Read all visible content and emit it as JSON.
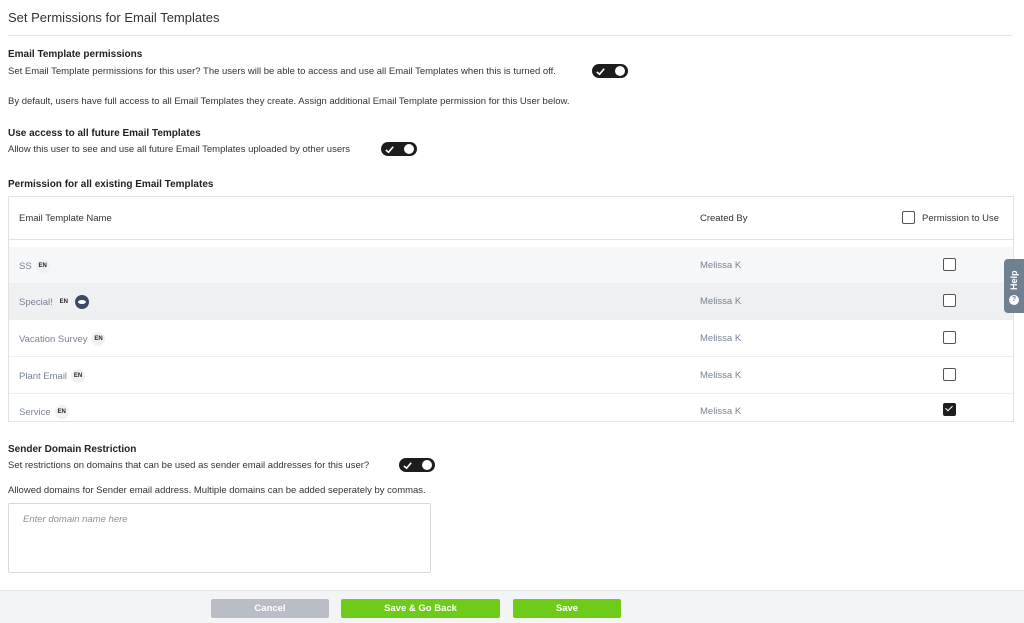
{
  "page": {
    "title": "Set Permissions for Email Templates"
  },
  "email_permissions": {
    "heading": "Email Template permissions",
    "description": "Set Email Template permissions for this user? The users will be able to access and use all Email Templates when this is turned off.",
    "toggle_on": true,
    "note": "By default, users have full access to all Email Templates they create. Assign additional Email Template permission for this User below."
  },
  "future_access": {
    "heading": "Use access to all future Email Templates",
    "description": "Allow this user to see and use all future Email Templates uploaded by other users",
    "toggle_on": true
  },
  "existing": {
    "heading": "Permission for all existing Email Templates",
    "columns": {
      "name": "Email Template Name",
      "created_by": "Created By",
      "permission": "Permission to Use"
    },
    "rows": [
      {
        "name": "SS",
        "lang": "EN",
        "created_by": "Melissa K",
        "permitted": false,
        "highlight": true,
        "preview": false
      },
      {
        "name": "Special!",
        "lang": "EN",
        "created_by": "Melissa K",
        "permitted": false,
        "highlight": true,
        "preview": true
      },
      {
        "name": "Vacation Survey",
        "lang": "EN",
        "created_by": "Melissa K",
        "permitted": false,
        "highlight": false,
        "preview": false
      },
      {
        "name": "Plant Email",
        "lang": "EN",
        "created_by": "Melissa K",
        "permitted": false,
        "highlight": false,
        "preview": false
      },
      {
        "name": "Service",
        "lang": "EN",
        "created_by": "Melissa K",
        "permitted": true,
        "highlight": false,
        "preview": false
      }
    ]
  },
  "sender_domain": {
    "heading": "Sender Domain Restriction",
    "description": "Set restrictions on domains that can be used as sender email addresses for this user?",
    "toggle_on": true,
    "help": "Allowed domains for Sender email address. Multiple domains can be added seperately by commas.",
    "placeholder": "Enter domain name here",
    "value": ""
  },
  "help_tab": {
    "label": "Help",
    "icon": "question-icon"
  },
  "footer": {
    "cancel": "Cancel",
    "save_go_back": "Save & Go Back",
    "save": "Save"
  },
  "colors": {
    "toggle": "#1d1d1f",
    "primary_button": "#6ecb1a",
    "cancel_button": "#b9bec6",
    "help_tab": "#6f8191"
  }
}
